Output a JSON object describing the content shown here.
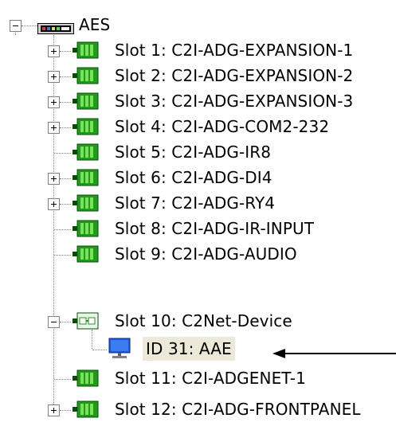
{
  "tree": {
    "root": {
      "label": "AES",
      "expanded": true,
      "icon": "device-chassis-icon"
    },
    "children": [
      {
        "label": "Slot 1: C2I-ADG-EXPANSION-1",
        "has_children": true,
        "expanded": false,
        "icon": "card-green-icon"
      },
      {
        "label": "Slot 2: C2I-ADG-EXPANSION-2",
        "has_children": true,
        "expanded": false,
        "icon": "card-green-icon"
      },
      {
        "label": "Slot 3: C2I-ADG-EXPANSION-3",
        "has_children": true,
        "expanded": false,
        "icon": "card-green-icon"
      },
      {
        "label": "Slot 4: C2I-ADG-COM2-232",
        "has_children": true,
        "expanded": false,
        "icon": "card-green-icon"
      },
      {
        "label": "Slot 5: C2I-ADG-IR8",
        "has_children": false,
        "icon": "card-green-icon"
      },
      {
        "label": "Slot 6: C2I-ADG-DI4",
        "has_children": true,
        "expanded": false,
        "icon": "card-green-icon"
      },
      {
        "label": "Slot 7: C2I-ADG-RY4",
        "has_children": true,
        "expanded": false,
        "icon": "card-green-icon"
      },
      {
        "label": "Slot 8: C2I-ADG-IR-INPUT",
        "has_children": false,
        "icon": "card-green-icon"
      },
      {
        "label": "Slot 9: C2I-ADG-AUDIO",
        "has_children": false,
        "icon": "card-green-icon"
      },
      {
        "label": "Slot 10: C2Net-Device",
        "has_children": true,
        "expanded": true,
        "icon": "network-card-icon",
        "children": [
          {
            "label": "ID 31: AAE",
            "selected": true,
            "icon": "computer-monitor-icon"
          }
        ]
      },
      {
        "label": "Slot 11: C2I-ADGENET-1",
        "has_children": false,
        "icon": "card-green-icon"
      },
      {
        "label": "Slot 12: C2I-ADG-FRONTPANEL",
        "has_children": true,
        "expanded": false,
        "icon": "card-green-icon"
      }
    ]
  },
  "annotation": {
    "icon": "arrow-left-icon",
    "target": "ID 31: AAE"
  },
  "colors": {
    "card_green": "#1f9a1a",
    "card_green_light": "#7be05a",
    "monitor_blue": "#1e5ae0",
    "selection_bg": "#ece9d8",
    "dotted_line": "#808080"
  }
}
